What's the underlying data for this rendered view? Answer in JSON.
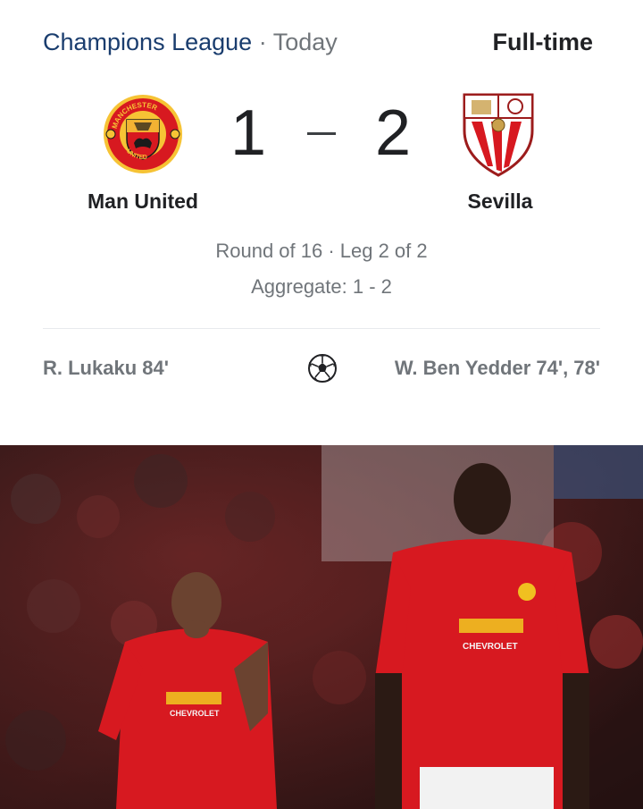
{
  "header": {
    "competition": "Champions League",
    "separator": "·",
    "date": "Today",
    "status": "Full-time"
  },
  "home": {
    "name": "Man United",
    "score": "1",
    "crest_icon": "man-united-crest-icon",
    "scorers": "R. Lukaku 84'"
  },
  "away": {
    "name": "Sevilla",
    "score": "2",
    "crest_icon": "sevilla-crest-icon",
    "scorers": "W. Ben Yedder 74', 78'"
  },
  "match": {
    "round": "Round of 16 · Leg 2 of 2",
    "aggregate": "Aggregate: 1 - 2",
    "goal_icon": "soccer-ball-icon"
  },
  "colors": {
    "competition": "#1a3d6e",
    "muted": "#70757a",
    "text": "#202124",
    "kit_red": "#d71920"
  },
  "photo": {
    "sponsor_text": "CHEVROLET"
  }
}
